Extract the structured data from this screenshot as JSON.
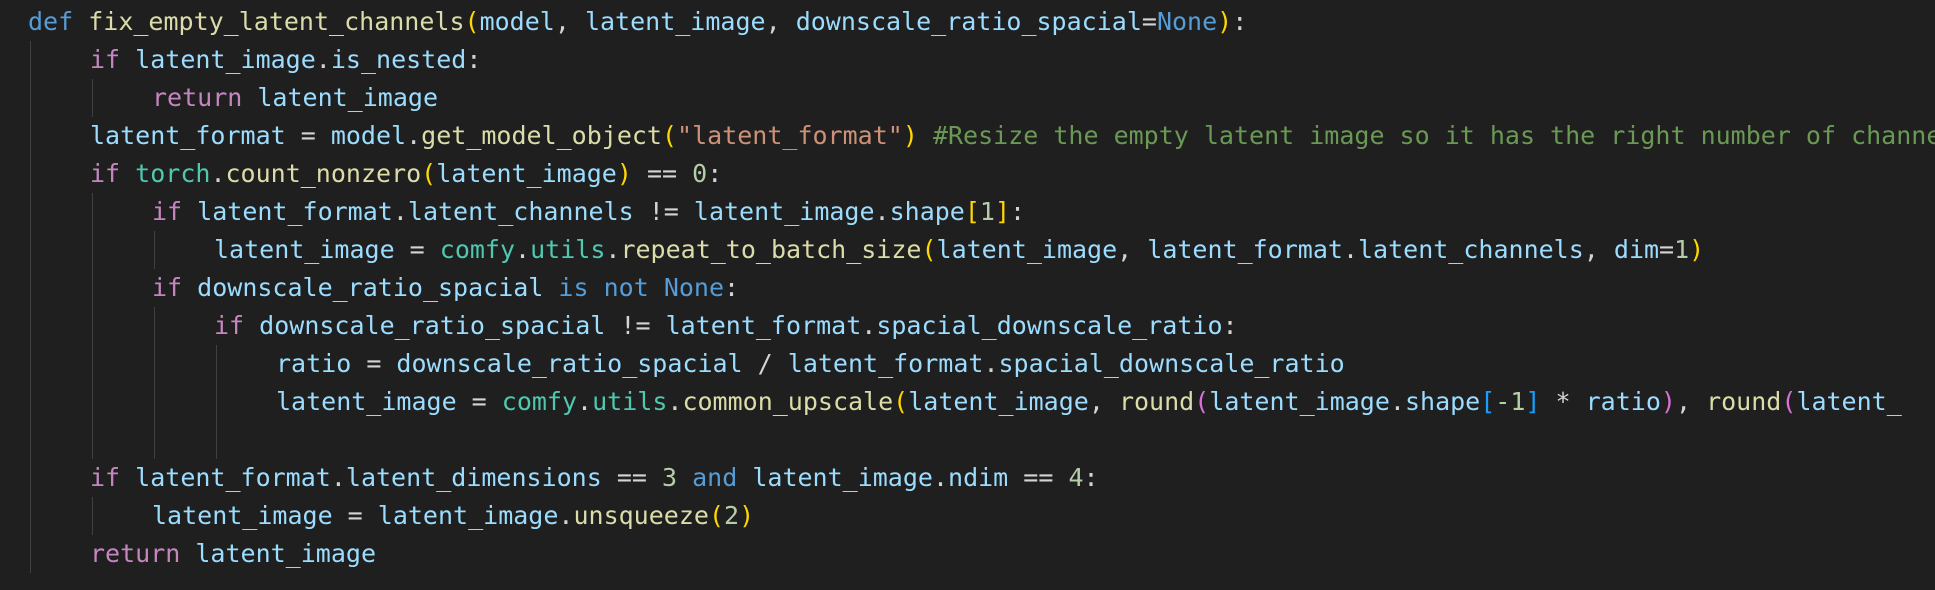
{
  "colors": {
    "background": "#1f1f1f",
    "kw_storage": "#569cd6",
    "kw_control": "#c586c0",
    "function": "#dcdcaa",
    "variable": "#9cdcfe",
    "module": "#4ec9b0",
    "string": "#ce9178",
    "comment": "#6a9955",
    "number": "#b5cea8",
    "plain": "#d4d4d4",
    "bracket_gold": "#ffd700",
    "bracket_pink": "#da70d6",
    "bracket_blue": "#179fff"
  },
  "editor": {
    "lines": [
      {
        "indent": 0,
        "tokens": [
          {
            "t": "def",
            "c": "kw_storage"
          },
          {
            "t": " ",
            "c": "plain"
          },
          {
            "t": "fix_empty_latent_channels",
            "c": "function"
          },
          {
            "t": "(",
            "c": "bracket_gold"
          },
          {
            "t": "model",
            "c": "variable"
          },
          {
            "t": ", ",
            "c": "plain"
          },
          {
            "t": "latent_image",
            "c": "variable"
          },
          {
            "t": ", ",
            "c": "plain"
          },
          {
            "t": "downscale_ratio_spacial",
            "c": "variable"
          },
          {
            "t": "=",
            "c": "plain"
          },
          {
            "t": "None",
            "c": "kw_storage"
          },
          {
            "t": ")",
            "c": "bracket_gold"
          },
          {
            "t": ":",
            "c": "plain"
          }
        ]
      },
      {
        "indent": 1,
        "tokens": [
          {
            "t": "if",
            "c": "kw_control"
          },
          {
            "t": " ",
            "c": "plain"
          },
          {
            "t": "latent_image",
            "c": "variable"
          },
          {
            "t": ".",
            "c": "plain"
          },
          {
            "t": "is_nested",
            "c": "variable"
          },
          {
            "t": ":",
            "c": "plain"
          }
        ]
      },
      {
        "indent": 2,
        "tokens": [
          {
            "t": "return",
            "c": "kw_control"
          },
          {
            "t": " ",
            "c": "plain"
          },
          {
            "t": "latent_image",
            "c": "variable"
          }
        ]
      },
      {
        "indent": 1,
        "tokens": [
          {
            "t": "latent_format",
            "c": "variable"
          },
          {
            "t": " = ",
            "c": "plain"
          },
          {
            "t": "model",
            "c": "variable"
          },
          {
            "t": ".",
            "c": "plain"
          },
          {
            "t": "get_model_object",
            "c": "function"
          },
          {
            "t": "(",
            "c": "bracket_gold"
          },
          {
            "t": "\"latent_format\"",
            "c": "string"
          },
          {
            "t": ")",
            "c": "bracket_gold"
          },
          {
            "t": " ",
            "c": "plain"
          },
          {
            "t": "#Resize the empty latent image so it has the right number of channels",
            "c": "comment"
          }
        ]
      },
      {
        "indent": 1,
        "tokens": [
          {
            "t": "if",
            "c": "kw_control"
          },
          {
            "t": " ",
            "c": "plain"
          },
          {
            "t": "torch",
            "c": "module"
          },
          {
            "t": ".",
            "c": "plain"
          },
          {
            "t": "count_nonzero",
            "c": "function"
          },
          {
            "t": "(",
            "c": "bracket_gold"
          },
          {
            "t": "latent_image",
            "c": "variable"
          },
          {
            "t": ")",
            "c": "bracket_gold"
          },
          {
            "t": " == ",
            "c": "plain"
          },
          {
            "t": "0",
            "c": "number"
          },
          {
            "t": ":",
            "c": "plain"
          }
        ]
      },
      {
        "indent": 2,
        "tokens": [
          {
            "t": "if",
            "c": "kw_control"
          },
          {
            "t": " ",
            "c": "plain"
          },
          {
            "t": "latent_format",
            "c": "variable"
          },
          {
            "t": ".",
            "c": "plain"
          },
          {
            "t": "latent_channels",
            "c": "variable"
          },
          {
            "t": " != ",
            "c": "plain"
          },
          {
            "t": "latent_image",
            "c": "variable"
          },
          {
            "t": ".",
            "c": "plain"
          },
          {
            "t": "shape",
            "c": "variable"
          },
          {
            "t": "[",
            "c": "bracket_gold"
          },
          {
            "t": "1",
            "c": "number"
          },
          {
            "t": "]",
            "c": "bracket_gold"
          },
          {
            "t": ":",
            "c": "plain"
          }
        ]
      },
      {
        "indent": 3,
        "tokens": [
          {
            "t": "latent_image",
            "c": "variable"
          },
          {
            "t": " = ",
            "c": "plain"
          },
          {
            "t": "comfy",
            "c": "module"
          },
          {
            "t": ".",
            "c": "plain"
          },
          {
            "t": "utils",
            "c": "module"
          },
          {
            "t": ".",
            "c": "plain"
          },
          {
            "t": "repeat_to_batch_size",
            "c": "function"
          },
          {
            "t": "(",
            "c": "bracket_gold"
          },
          {
            "t": "latent_image",
            "c": "variable"
          },
          {
            "t": ", ",
            "c": "plain"
          },
          {
            "t": "latent_format",
            "c": "variable"
          },
          {
            "t": ".",
            "c": "plain"
          },
          {
            "t": "latent_channels",
            "c": "variable"
          },
          {
            "t": ", ",
            "c": "plain"
          },
          {
            "t": "dim",
            "c": "variable"
          },
          {
            "t": "=",
            "c": "plain"
          },
          {
            "t": "1",
            "c": "number"
          },
          {
            "t": ")",
            "c": "bracket_gold"
          }
        ]
      },
      {
        "indent": 2,
        "tokens": [
          {
            "t": "if",
            "c": "kw_control"
          },
          {
            "t": " ",
            "c": "plain"
          },
          {
            "t": "downscale_ratio_spacial",
            "c": "variable"
          },
          {
            "t": " ",
            "c": "plain"
          },
          {
            "t": "is",
            "c": "kw_storage"
          },
          {
            "t": " ",
            "c": "plain"
          },
          {
            "t": "not",
            "c": "kw_storage"
          },
          {
            "t": " ",
            "c": "plain"
          },
          {
            "t": "None",
            "c": "kw_storage"
          },
          {
            "t": ":",
            "c": "plain"
          }
        ]
      },
      {
        "indent": 3,
        "tokens": [
          {
            "t": "if",
            "c": "kw_control"
          },
          {
            "t": " ",
            "c": "plain"
          },
          {
            "t": "downscale_ratio_spacial",
            "c": "variable"
          },
          {
            "t": " != ",
            "c": "plain"
          },
          {
            "t": "latent_format",
            "c": "variable"
          },
          {
            "t": ".",
            "c": "plain"
          },
          {
            "t": "spacial_downscale_ratio",
            "c": "variable"
          },
          {
            "t": ":",
            "c": "plain"
          }
        ]
      },
      {
        "indent": 4,
        "tokens": [
          {
            "t": "ratio",
            "c": "variable"
          },
          {
            "t": " = ",
            "c": "plain"
          },
          {
            "t": "downscale_ratio_spacial",
            "c": "variable"
          },
          {
            "t": " / ",
            "c": "plain"
          },
          {
            "t": "latent_format",
            "c": "variable"
          },
          {
            "t": ".",
            "c": "plain"
          },
          {
            "t": "spacial_downscale_ratio",
            "c": "variable"
          }
        ]
      },
      {
        "indent": 4,
        "tokens": [
          {
            "t": "latent_image",
            "c": "variable"
          },
          {
            "t": " = ",
            "c": "plain"
          },
          {
            "t": "comfy",
            "c": "module"
          },
          {
            "t": ".",
            "c": "plain"
          },
          {
            "t": "utils",
            "c": "module"
          },
          {
            "t": ".",
            "c": "plain"
          },
          {
            "t": "common_upscale",
            "c": "function"
          },
          {
            "t": "(",
            "c": "bracket_gold"
          },
          {
            "t": "latent_image",
            "c": "variable"
          },
          {
            "t": ", ",
            "c": "plain"
          },
          {
            "t": "round",
            "c": "function"
          },
          {
            "t": "(",
            "c": "bracket_pink"
          },
          {
            "t": "latent_image",
            "c": "variable"
          },
          {
            "t": ".",
            "c": "plain"
          },
          {
            "t": "shape",
            "c": "variable"
          },
          {
            "t": "[",
            "c": "bracket_blue"
          },
          {
            "t": "-1",
            "c": "number"
          },
          {
            "t": "]",
            "c": "bracket_blue"
          },
          {
            "t": " * ",
            "c": "plain"
          },
          {
            "t": "ratio",
            "c": "variable"
          },
          {
            "t": ")",
            "c": "bracket_pink"
          },
          {
            "t": ", ",
            "c": "plain"
          },
          {
            "t": "round",
            "c": "function"
          },
          {
            "t": "(",
            "c": "bracket_pink"
          },
          {
            "t": "latent_",
            "c": "variable"
          }
        ]
      },
      {
        "indent": 0,
        "blank": true,
        "guides": 4,
        "tokens": []
      },
      {
        "indent": 1,
        "tokens": [
          {
            "t": "if",
            "c": "kw_control"
          },
          {
            "t": " ",
            "c": "plain"
          },
          {
            "t": "latent_format",
            "c": "variable"
          },
          {
            "t": ".",
            "c": "plain"
          },
          {
            "t": "latent_dimensions",
            "c": "variable"
          },
          {
            "t": " == ",
            "c": "plain"
          },
          {
            "t": "3",
            "c": "number"
          },
          {
            "t": " ",
            "c": "plain"
          },
          {
            "t": "and",
            "c": "kw_storage"
          },
          {
            "t": " ",
            "c": "plain"
          },
          {
            "t": "latent_image",
            "c": "variable"
          },
          {
            "t": ".",
            "c": "plain"
          },
          {
            "t": "ndim",
            "c": "variable"
          },
          {
            "t": " == ",
            "c": "plain"
          },
          {
            "t": "4",
            "c": "number"
          },
          {
            "t": ":",
            "c": "plain"
          }
        ]
      },
      {
        "indent": 2,
        "tokens": [
          {
            "t": "latent_image",
            "c": "variable"
          },
          {
            "t": " = ",
            "c": "plain"
          },
          {
            "t": "latent_image",
            "c": "variable"
          },
          {
            "t": ".",
            "c": "plain"
          },
          {
            "t": "unsqueeze",
            "c": "function"
          },
          {
            "t": "(",
            "c": "bracket_gold"
          },
          {
            "t": "2",
            "c": "number"
          },
          {
            "t": ")",
            "c": "bracket_gold"
          }
        ]
      },
      {
        "indent": 1,
        "tokens": [
          {
            "t": "return",
            "c": "kw_control"
          },
          {
            "t": " ",
            "c": "plain"
          },
          {
            "t": "latent_image",
            "c": "variable"
          }
        ]
      }
    ]
  }
}
